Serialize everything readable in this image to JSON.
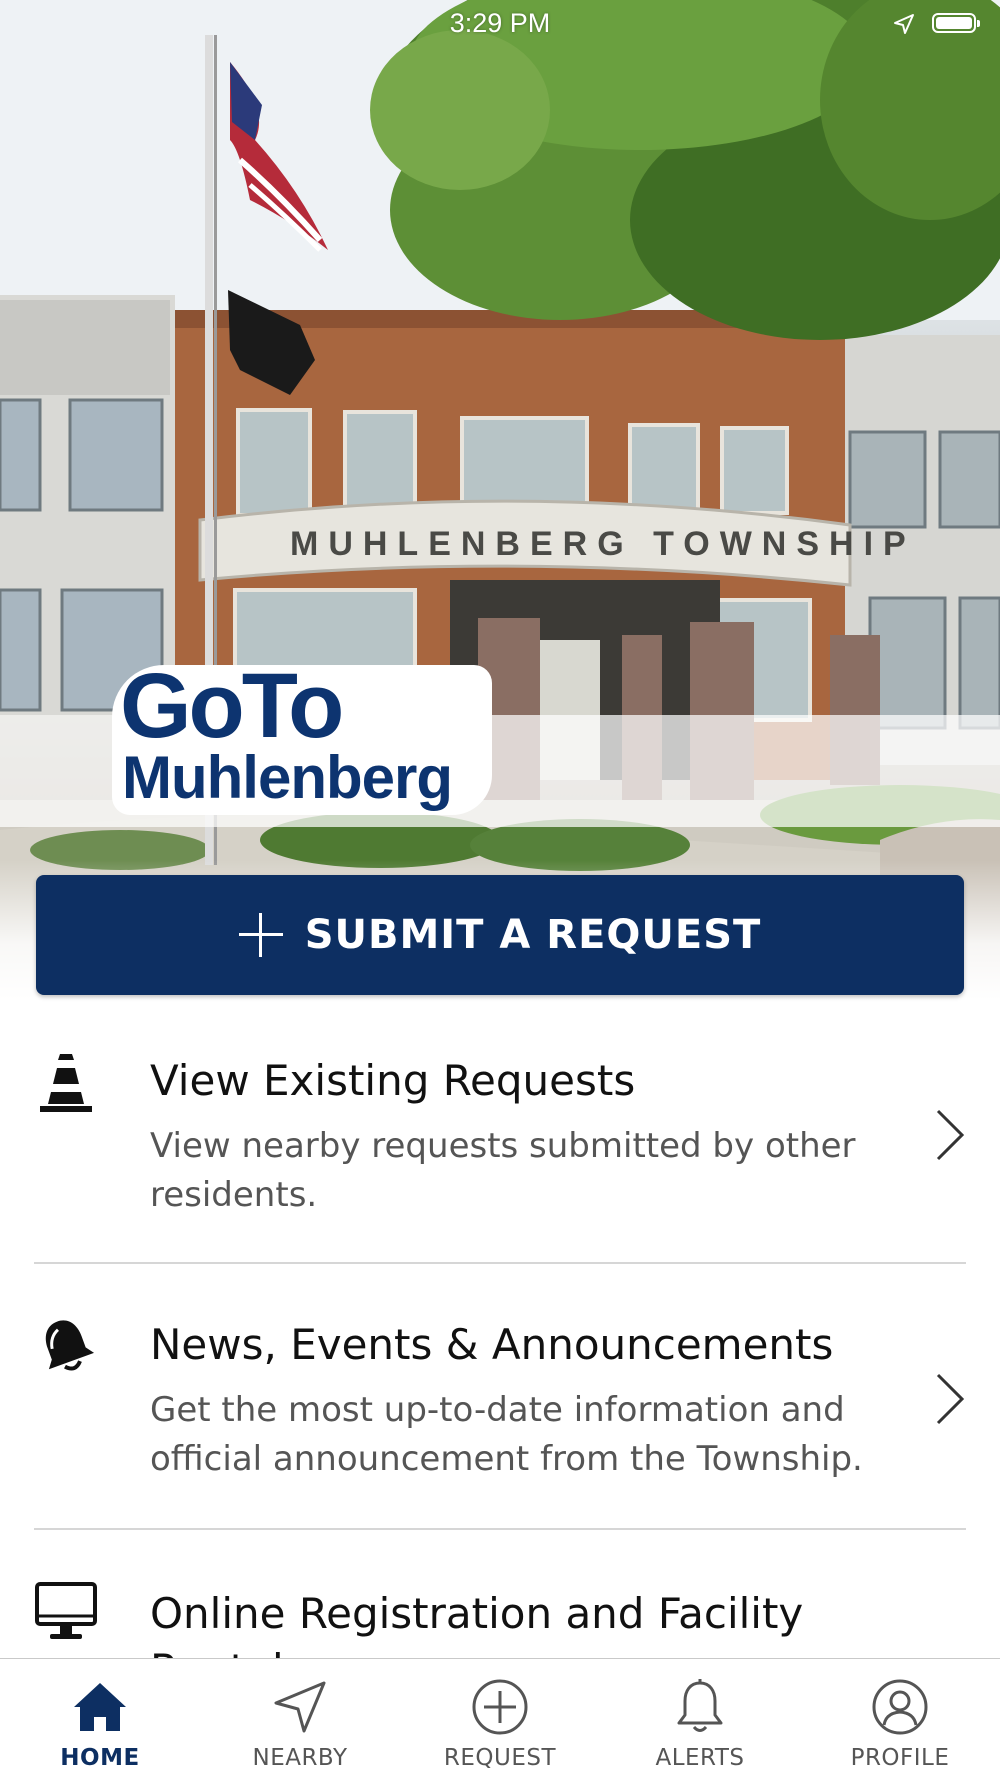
{
  "status_bar": {
    "time": "3:29 PM"
  },
  "hero": {
    "building_sign": "MUHLENBERG TOWNSHIP",
    "logo": {
      "line1": "GoTo",
      "line2": "Muhlenberg"
    }
  },
  "submit_button": {
    "label": "SUBMIT A REQUEST",
    "icon": "plus-icon"
  },
  "list": {
    "items": [
      {
        "title": "View Existing Requests",
        "description": "View nearby requests submitted by other residents.",
        "icon": "traffic-cone-icon"
      },
      {
        "title": "News, Events & Announcements",
        "description": "Get the most up-to-date information and official announcement from the Township.",
        "icon": "bell-icon"
      },
      {
        "title": "Online Registration and Facility Rentals",
        "description": "",
        "icon": "computer-monitor-icon"
      }
    ]
  },
  "tab_bar": {
    "tabs": [
      {
        "label": "HOME",
        "icon": "home-icon",
        "active": true
      },
      {
        "label": "NEARBY",
        "icon": "location-arrow-icon",
        "active": false
      },
      {
        "label": "REQUEST",
        "icon": "plus-circle-icon",
        "active": false
      },
      {
        "label": "ALERTS",
        "icon": "bell-icon",
        "active": false
      },
      {
        "label": "PROFILE",
        "icon": "user-circle-icon",
        "active": false
      }
    ]
  },
  "colors": {
    "brand_navy": "#0d2f62",
    "logo_blue": "#0d3470",
    "text_primary": "#111111",
    "text_secondary": "#555555",
    "divider": "#d6d6d6"
  }
}
